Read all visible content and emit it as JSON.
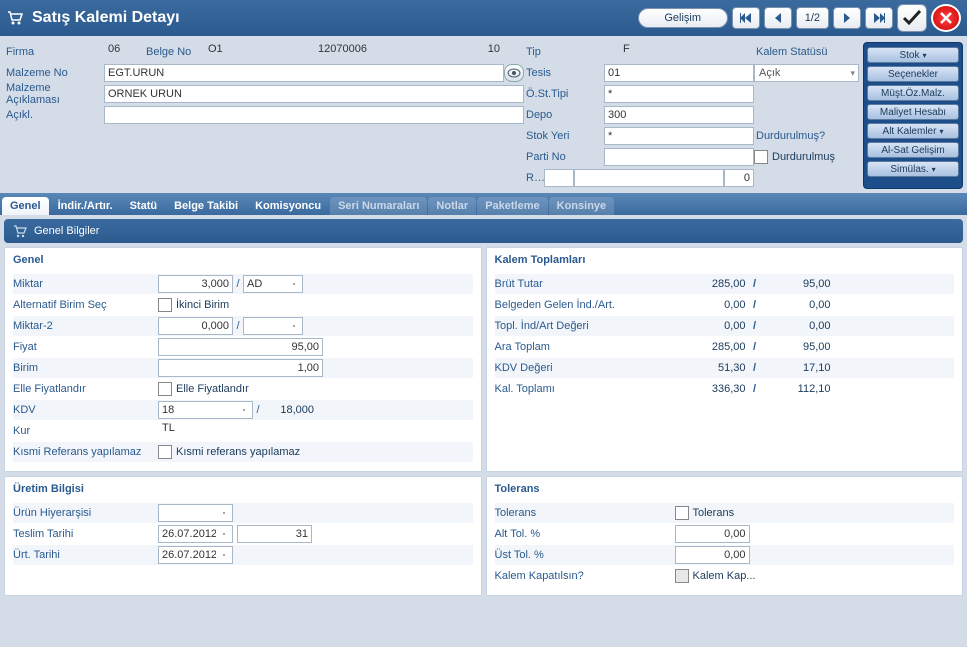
{
  "title": "Satış Kalemi Detayı",
  "toolbar": {
    "gelisim": "Gelişim",
    "nav_counter": "1/2"
  },
  "sidebar_buttons": [
    "Stok",
    "Seçenekler",
    "Müşt.Öz.Malz.",
    "Maliyet Hesabı",
    "Alt Kalemler",
    "Al-Sat Gelişim",
    "Simülas."
  ],
  "header": {
    "firma": {
      "label": "Firma",
      "value": "06"
    },
    "belge_no": {
      "label": "Belge No",
      "val1": "O1",
      "val2": "12070006",
      "val3": "10"
    },
    "malzeme_no": {
      "label": "Malzeme No",
      "value": "EGT.URUN"
    },
    "malzeme_acik": {
      "label": "Malzeme Açıklaması",
      "value": "ORNEK URUN"
    },
    "acikl": {
      "label": "Açıkl.",
      "value": ""
    },
    "tip": {
      "label": "Tip",
      "value": "F"
    },
    "tesis": {
      "label": "Tesis",
      "value": "01"
    },
    "ost_tipi": {
      "label": "Ö.St.Tipi",
      "value": "*"
    },
    "depo": {
      "label": "Depo",
      "value": "300"
    },
    "stok_yeri": {
      "label": "Stok Yeri",
      "value": "*"
    },
    "parti_no": {
      "label": "Parti No",
      "value": ""
    },
    "ref_dok": {
      "label": "Ref.Dök.Tipi / No /K...",
      "val1": "",
      "val2": "",
      "val3": "0"
    },
    "kalem_statusu": {
      "label": "Kalem Statüsü",
      "value": "Açık"
    },
    "durdurulmus_q": "Durdurulmuş?",
    "durdurulmus": "Durdurulmuş"
  },
  "tabs": [
    "Genel",
    "İndir./Artır.",
    "Statü",
    "Belge Takibi",
    "Komisyoncu",
    "Seri Numaraları",
    "Notlar",
    "Paketleme",
    "Konsinye"
  ],
  "section_header": "Genel Bilgiler",
  "genel": {
    "title": "Genel",
    "miktar": {
      "label": "Miktar",
      "value": "3,000",
      "unit": "AD"
    },
    "alt_birim": {
      "label": "Alternatif Birim Seç",
      "chk": "İkinci Birim"
    },
    "miktar2": {
      "label": "Miktar-2",
      "value": "0,000",
      "unit": ""
    },
    "fiyat": {
      "label": "Fiyat",
      "value": "95,00"
    },
    "birim": {
      "label": "Birim",
      "value": "1,00"
    },
    "elle_fiyat": {
      "label": "Elle Fiyatlandır",
      "chk": "Elle Fiyatlandır"
    },
    "kdv": {
      "label": "KDV",
      "value": "18",
      "rate": "18,000"
    },
    "kur": {
      "label": "Kur",
      "value": "TL"
    },
    "kismi_ref": {
      "label": "Kısmi Referans yapılamaz",
      "chk": "Kısmi referans yapılamaz"
    }
  },
  "kalem_toplamlari": {
    "title": "Kalem Toplamları",
    "rows": [
      {
        "label": "Brüt Tutar",
        "v1": "285,00",
        "v2": "95,00"
      },
      {
        "label": "Belgeden Gelen İnd./Art.",
        "v1": "0,00",
        "v2": "0,00"
      },
      {
        "label": "Topl. İnd/Art Değeri",
        "v1": "0,00",
        "v2": "0,00"
      },
      {
        "label": "Ara Toplam",
        "v1": "285,00",
        "v2": "95,00"
      },
      {
        "label": "KDV Değeri",
        "v1": "51,30",
        "v2": "17,10"
      },
      {
        "label": "Kal. Toplamı",
        "v1": "336,30",
        "v2": "112,10"
      }
    ]
  },
  "uretim": {
    "title": "Üretim Bilgisi",
    "urun_hiy": {
      "label": "Ürün Hiyerarşisi",
      "value": ""
    },
    "teslim": {
      "label": "Teslim Tarihi",
      "value": "26.07.2012",
      "extra": "31"
    },
    "urt": {
      "label": "Ürt. Tarihi",
      "value": "26.07.2012"
    }
  },
  "tolerans": {
    "title": "Tolerans",
    "tol": {
      "label": "Tolerans",
      "chk": "Tolerans"
    },
    "alt": {
      "label": "Alt Tol. %",
      "value": "0,00"
    },
    "ust": {
      "label": "Üst Tol. %",
      "value": "0,00"
    },
    "kap": {
      "label": "Kalem Kapatılsın?",
      "chk": "Kalem Kap..."
    }
  }
}
